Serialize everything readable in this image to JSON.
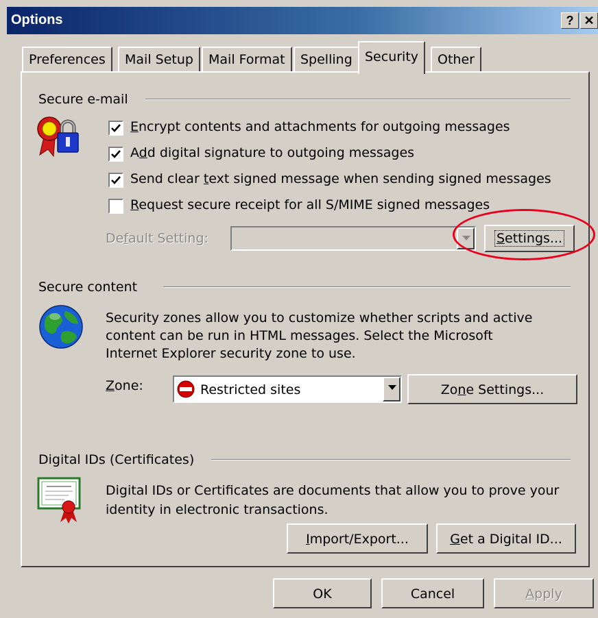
{
  "window": {
    "title": "Options",
    "help_glyph": "?",
    "close_glyph": "✕"
  },
  "tabs": [
    {
      "label": "Preferences"
    },
    {
      "label": "Mail Setup"
    },
    {
      "label": "Mail Format"
    },
    {
      "label": "Spelling"
    },
    {
      "label": "Security"
    },
    {
      "label": "Other"
    }
  ],
  "secure_email": {
    "title": "Secure e-mail",
    "checkboxes": [
      {
        "pre": "",
        "mn": "E",
        "post": "ncrypt contents and attachments for outgoing messages",
        "checked": true
      },
      {
        "pre": "A",
        "mn": "d",
        "post": "d digital signature to outgoing messages",
        "checked": true
      },
      {
        "pre": "Send clear ",
        "mn": "t",
        "post": "ext signed message when sending signed messages",
        "checked": true
      },
      {
        "pre": "",
        "mn": "R",
        "post": "equest secure receipt for all S/MIME signed messages",
        "checked": false
      }
    ],
    "default_setting": {
      "pre": "De",
      "mn": "f",
      "post": "ault Setting:",
      "value": ""
    },
    "settings_button": {
      "pre": "",
      "mn": "S",
      "post": "ettings..."
    }
  },
  "secure_content": {
    "title": "Secure content",
    "description_lines": [
      "Security zones allow you to customize whether scripts and active",
      "content can be run in HTML messages.  Select the Microsoft",
      "Internet Explorer security zone to use."
    ],
    "zone_label": {
      "pre": "",
      "mn": "Z",
      "post": "one:"
    },
    "zone_value": "Restricted sites",
    "zone_settings_button": {
      "pre": "Zo",
      "mn": "n",
      "post": "e Settings..."
    }
  },
  "digital_ids": {
    "title": "Digital IDs (Certificates)",
    "description_lines": [
      "Digital IDs or Certificates are documents that allow you to prove your",
      "identity in electronic transactions."
    ],
    "import_export_button": {
      "pre": "",
      "mn": "I",
      "post": "mport/Export..."
    },
    "get_id_button": {
      "pre": "",
      "mn": "G",
      "post": "et a Digital ID..."
    }
  },
  "footer": {
    "ok": "OK",
    "cancel": "Cancel",
    "apply": {
      "pre": "",
      "mn": "A",
      "post": "pply"
    }
  },
  "colors": {
    "annotation": "#e8001c",
    "titlebar": "#0a246a",
    "face": "#d4d0c8"
  }
}
